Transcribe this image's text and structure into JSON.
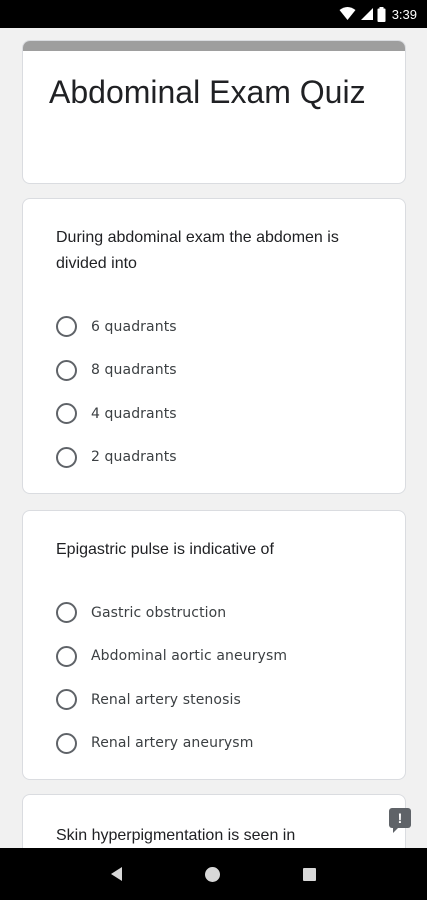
{
  "status_bar": {
    "time": "3:39",
    "icons": [
      "wifi-icon",
      "signal-icon",
      "battery-icon"
    ]
  },
  "form": {
    "title": "Abdominal Exam Quiz"
  },
  "questions": [
    {
      "text": "During abdominal exam the abdomen is divided into",
      "options": [
        "6 quadrants",
        "8 quadrants",
        "4 quadrants",
        "2 quadrants"
      ]
    },
    {
      "text": "Epigastric pulse is indicative of",
      "options": [
        "Gastric obstruction",
        "Abdominal aortic aneurysm",
        "Renal artery stenosis",
        "Renal artery aneurysm"
      ]
    },
    {
      "text": "Skin hyperpigmentation is seen in",
      "options": []
    }
  ],
  "feedback": {
    "label": "!"
  },
  "colors": {
    "background": "#f1f1f1",
    "card": "#ffffff",
    "header_stripe": "#9e9e9e",
    "radio_border": "#5f6368"
  }
}
